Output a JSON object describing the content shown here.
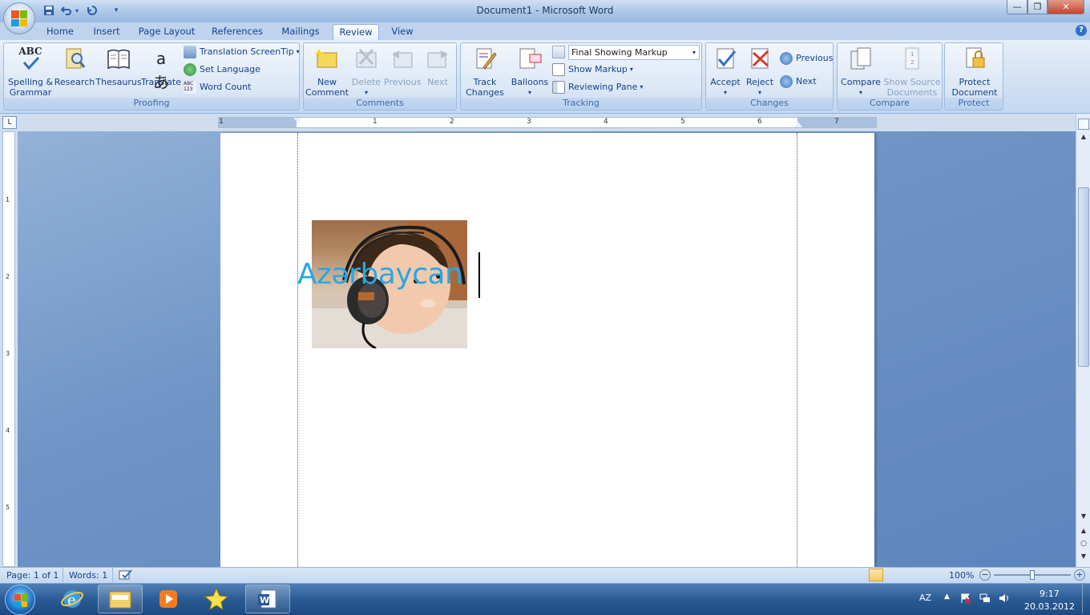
{
  "window": {
    "title": "Document1 - Microsoft Word",
    "controls": {
      "minimize": "—",
      "restore": "❐",
      "close": "✕"
    }
  },
  "qat": {
    "save_icon": "save-icon",
    "undo_icon": "undo-icon",
    "redo_icon": "redo-icon",
    "customize": "▾"
  },
  "tabs": [
    "Home",
    "Insert",
    "Page Layout",
    "References",
    "Mailings",
    "Review",
    "View"
  ],
  "active_tab": "Review",
  "ribbon": {
    "proofing": {
      "label": "Proofing",
      "spelling": "Spelling &\nGrammar",
      "spelling_top": "ABC",
      "research": "Research",
      "thesaurus": "Thesaurus",
      "translate": "Translate",
      "translate_glyph": "aあ",
      "translation_screentip": "Translation ScreenTip",
      "set_language": "Set Language",
      "word_count": "Word Count",
      "word_count_glyph": "ABC\n123"
    },
    "comments": {
      "label": "Comments",
      "new_comment": "New\nComment",
      "delete": "Delete",
      "previous": "Previous",
      "next": "Next"
    },
    "tracking": {
      "label": "Tracking",
      "track_changes": "Track\nChanges",
      "balloons": "Balloons",
      "display_select": "Final Showing Markup",
      "show_markup": "Show Markup",
      "reviewing_pane": "Reviewing Pane"
    },
    "changes": {
      "label": "Changes",
      "accept": "Accept",
      "reject": "Reject",
      "previous": "Previous",
      "next": "Next"
    },
    "compare": {
      "label": "Compare",
      "compare": "Compare",
      "show_source": "Show Source\nDocuments"
    },
    "protect": {
      "label": "Protect",
      "protect_document": "Protect\nDocument"
    }
  },
  "ruler": {
    "corner": "L",
    "numbers": [
      "1",
      "1",
      "2",
      "3",
      "4",
      "5",
      "6",
      "7"
    ],
    "vnumbers": [
      "1",
      "2",
      "3",
      "4",
      "5"
    ]
  },
  "document": {
    "text": "Azərbaycan",
    "image": "baby-with-headphones"
  },
  "status": {
    "page": "Page: 1 of 1",
    "words": "Words: 1",
    "zoom": "100%",
    "zoom_level": 1.0
  },
  "taskbar": {
    "apps": [
      "start-orb",
      "internet-explorer-icon",
      "explorer-folder-icon",
      "media-player-icon",
      "star-app-icon",
      "word-icon"
    ],
    "language": "AZ",
    "time": "9:17",
    "date": "20.03.2012"
  },
  "colors": {
    "accent": "#15428b",
    "doc_text": "#29a7e3"
  }
}
